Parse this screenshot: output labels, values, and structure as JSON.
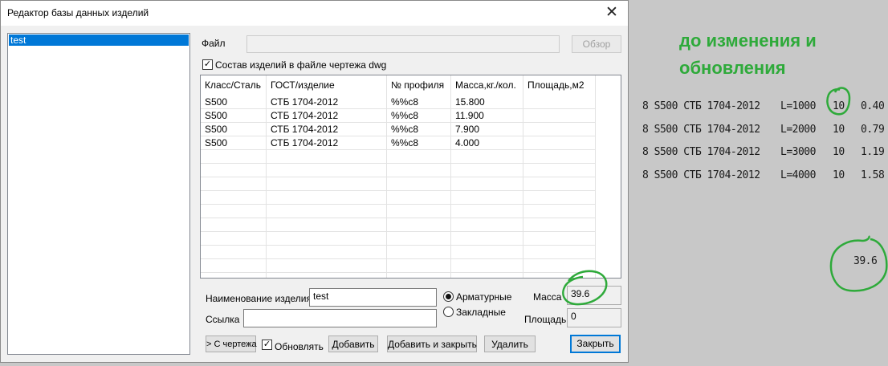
{
  "window": {
    "title": "Редактор базы данных изделий",
    "close_glyph": "✕"
  },
  "tree": {
    "items": [
      {
        "label": "test"
      }
    ]
  },
  "file": {
    "label": "Файл",
    "value": "",
    "browse_label": "Обзор"
  },
  "dwg_checkbox": {
    "label": "Состав изделий в файле чертежа dwg",
    "checked": true,
    "mark": "✓"
  },
  "table": {
    "headers": [
      "Класс/Сталь",
      "ГОСТ/изделие",
      "№ профиля",
      "Масса,кг./кол.",
      "Площадь,м2"
    ],
    "rows": [
      [
        "S500",
        "СТБ 1704-2012",
        "%%c8",
        "15.800",
        ""
      ],
      [
        "S500",
        "СТБ 1704-2012",
        "%%c8",
        "11.900",
        ""
      ],
      [
        "S500",
        "СТБ 1704-2012",
        "%%c8",
        "7.900",
        ""
      ],
      [
        "S500",
        "СТБ 1704-2012",
        "%%c8",
        "4.000",
        ""
      ]
    ]
  },
  "form": {
    "name_label": "Наименование изделия",
    "name_value": "test",
    "link_label": "Ссылка",
    "link_value": "",
    "radio_rebar": "Арматурные",
    "radio_embedded": "Закладные",
    "radio_selected": "rebar",
    "mass_label": "Масса",
    "mass_value": "39.6",
    "area_label": "Площадь",
    "area_value": "0"
  },
  "buttons": {
    "from_drawing": "> С чертежа",
    "update_label": "Обновлять",
    "update_checked": true,
    "update_mark": "✓",
    "add": "Добавить",
    "add_close": "Добавить и закрыть",
    "delete": "Удалить",
    "close": "Закрыть"
  },
  "drawing": {
    "note_line1": "до изменения и",
    "note_line2": "обновления",
    "note_color": "#2eaa3a",
    "rows": [
      {
        "spec": "8 S500 СТБ 1704-2012",
        "length": "L=1000",
        "qty": "10",
        "mass": "0.40"
      },
      {
        "spec": "8 S500 СТБ 1704-2012",
        "length": "L=2000",
        "qty": "10",
        "mass": "0.79"
      },
      {
        "spec": "8 S500 СТБ 1704-2012",
        "length": "L=3000",
        "qty": "10",
        "mass": "1.19"
      },
      {
        "spec": "8 S500 СТБ 1704-2012",
        "length": "L=4000",
        "qty": "10",
        "mass": "1.58"
      }
    ],
    "total": "39.6"
  },
  "colors": {
    "accent": "#0078d7",
    "annotation": "#2eaa3a",
    "drawing_bg": "#c8c8c8",
    "dialog_bg": "#f0f0f0"
  }
}
